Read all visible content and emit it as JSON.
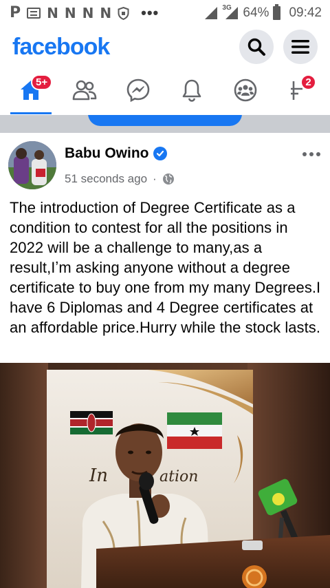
{
  "status_bar": {
    "left_glyphs": [
      "P",
      "N",
      "N",
      "N",
      "N"
    ],
    "more": "•••",
    "network": "3G",
    "battery": "64%",
    "time": "09:42"
  },
  "header": {
    "logo": "facebook",
    "brand_color": "#1877f2"
  },
  "tabs": [
    {
      "name": "home",
      "badge": "5+"
    },
    {
      "name": "friends"
    },
    {
      "name": "messenger"
    },
    {
      "name": "notifications"
    },
    {
      "name": "groups"
    },
    {
      "name": "menu",
      "badge": "2"
    }
  ],
  "post": {
    "author": "Babu Owino",
    "verified": true,
    "time": "51 seconds ago",
    "separator": "·",
    "audience_icon": "globe-icon",
    "text": "The introduction of Degree Certificate as a condition to contest for all the positions in 2022 will be a challenge to many,as a result,Iʼm asking anyone without a degree certificate to buy one from my many Degrees.I have 6 Diplomas and 4 Degree certificates at an affordable price.Hurry while the stock lasts.",
    "image_banner_text": "Inauguration"
  }
}
